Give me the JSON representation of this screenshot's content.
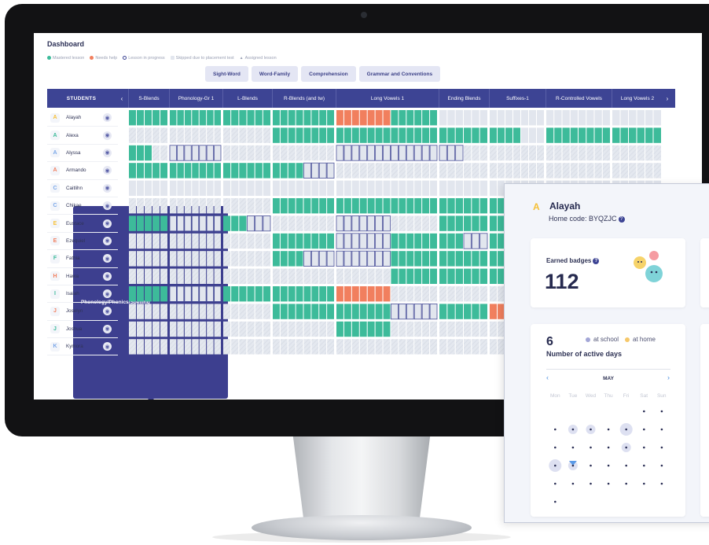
{
  "dashboard": {
    "title": "Dashboard",
    "legend": [
      {
        "label": "Mastered lesson",
        "color": "#3dbb9a",
        "shape": "dot"
      },
      {
        "label": "Needs help",
        "color": "#f17f5e",
        "shape": "dot"
      },
      {
        "label": "Lesson in progress",
        "color": "#ffffff",
        "shape": "ring"
      },
      {
        "label": "Skipped due to placement test",
        "color": "#e2e6ee",
        "shape": "square"
      },
      {
        "label": "Assigned lesson",
        "color": "#3d4494",
        "shape": "triangle"
      }
    ],
    "tabs": [
      "Phonology/Phonics/Spelling",
      "Sight-Word",
      "Word-Family",
      "Comprehension",
      "Grammar and Conventions"
    ],
    "active_tab": 0
  },
  "table": {
    "students_header": "STUDENTS",
    "columns": [
      "S-Blends",
      "Phonology-Gr 1",
      "L-Blends",
      "R-Blends (and tw)",
      "Long Vowels 1",
      "Ending Blends",
      "Suffixes-1",
      "R-Controlled Vowels",
      "Long Vowels 2"
    ],
    "students": [
      {
        "name": "Alayah",
        "initial": "A",
        "color": "#f6c037"
      },
      {
        "name": "Alexa",
        "initial": "A",
        "color": "#3dbb9a"
      },
      {
        "name": "Alyssa",
        "initial": "A",
        "color": "#7aa7e8"
      },
      {
        "name": "Armando",
        "initial": "A",
        "color": "#f17f5e"
      },
      {
        "name": "Caitlihn",
        "initial": "C",
        "color": "#7aa7e8"
      },
      {
        "name": "Chikae",
        "initial": "C",
        "color": "#7aa7e8"
      },
      {
        "name": "Eustace",
        "initial": "E",
        "color": "#f6c037"
      },
      {
        "name": "Ezequiel",
        "initial": "E",
        "color": "#f17f5e"
      },
      {
        "name": "Fathia",
        "initial": "F",
        "color": "#3dbb9a"
      },
      {
        "name": "Hawa",
        "initial": "H",
        "color": "#f17f5e"
      },
      {
        "name": "Isaiah",
        "initial": "I",
        "color": "#3dbb9a"
      },
      {
        "name": "Joselyn",
        "initial": "J",
        "color": "#f17f5e"
      },
      {
        "name": "Joshua",
        "initial": "J",
        "color": "#3dbb9a"
      },
      {
        "name": "Kymora",
        "initial": "K",
        "color": "#7aa7e8"
      }
    ]
  },
  "card": {
    "student_initial": "A",
    "student_name": "Alayah",
    "home_code": "Home code: BYQZJC",
    "earned_badges_label": "Earned badges",
    "earned_badges": "112",
    "active_days": "6",
    "active_days_label": "Number of active days",
    "legend_school": "at school",
    "legend_home": "at home",
    "month": "MAY",
    "weekdays": [
      "Mon",
      "Tue",
      "Wed",
      "Thu",
      "Fri",
      "Sat",
      "Sun"
    ]
  },
  "colors": {
    "mastered": "#3dbb9a",
    "needs_help": "#f17f5e",
    "skipped": "#e2e6ee",
    "header": "#3d4494",
    "school": "#a3a6d6",
    "home": "#f6c86a"
  }
}
